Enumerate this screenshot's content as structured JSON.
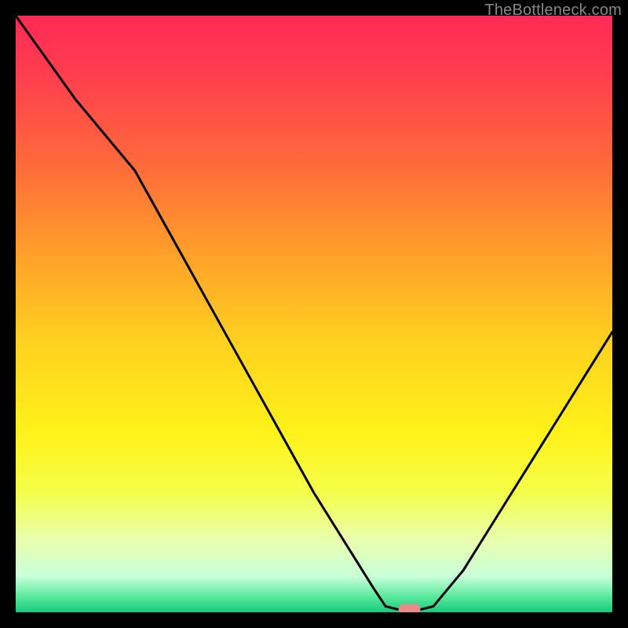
{
  "watermark": "TheBottleneck.com",
  "chart_data": {
    "type": "line",
    "title": "",
    "xlabel": "",
    "ylabel": "",
    "xlim": [
      0,
      100
    ],
    "ylim": [
      0,
      100
    ],
    "series": [
      {
        "name": "bottleneck-curve",
        "x": [
          0,
          5,
          10,
          15,
          20,
          25,
          30,
          35,
          40,
          45,
          50,
          55,
          60,
          62,
          64,
          66,
          68,
          70,
          75,
          80,
          85,
          90,
          95,
          100
        ],
        "y": [
          100,
          93,
          86,
          80,
          74,
          65,
          56,
          47,
          38,
          29,
          20,
          12,
          4,
          1,
          0.5,
          0.5,
          0.5,
          1,
          7,
          15,
          23,
          31,
          39,
          47
        ]
      }
    ],
    "marker": {
      "x": 66,
      "y": 0.5,
      "color": "#e98b8b"
    },
    "gradient_stops": [
      {
        "pos": 0.0,
        "color": "#ff2a55"
      },
      {
        "pos": 0.1,
        "color": "#ff3e4f"
      },
      {
        "pos": 0.25,
        "color": "#ff6a3a"
      },
      {
        "pos": 0.4,
        "color": "#ffa02a"
      },
      {
        "pos": 0.55,
        "color": "#ffd21f"
      },
      {
        "pos": 0.7,
        "color": "#fff21a"
      },
      {
        "pos": 0.8,
        "color": "#f4ff4a"
      },
      {
        "pos": 0.88,
        "color": "#e8ffb0"
      },
      {
        "pos": 0.94,
        "color": "#c8ffd8"
      },
      {
        "pos": 0.975,
        "color": "#55e89a"
      },
      {
        "pos": 1.0,
        "color": "#18c97a"
      }
    ]
  }
}
